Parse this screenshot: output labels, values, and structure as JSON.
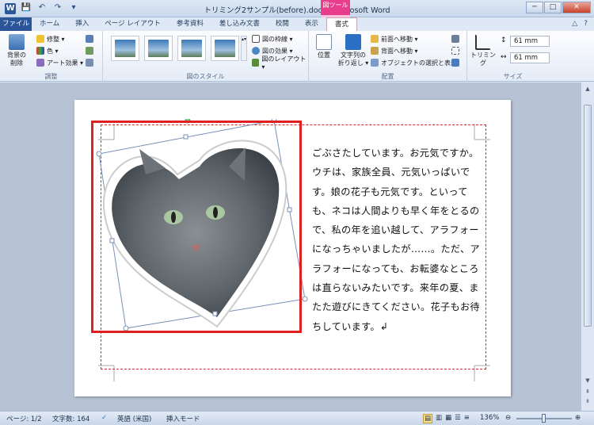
{
  "window": {
    "title": "トリミング2サンプル(before).docx - Microsoft Word",
    "context_tools": "図ツール",
    "app_icon": "W"
  },
  "quick_access": {
    "save": "💾",
    "undo": "↶",
    "redo": "↷",
    "customize": "▾"
  },
  "window_controls": {
    "minimize": "─",
    "maximize": "□",
    "close": "✕"
  },
  "tabs": [
    {
      "label": "ファイル"
    },
    {
      "label": "ホーム"
    },
    {
      "label": "挿入"
    },
    {
      "label": "ページ レイアウト"
    },
    {
      "label": "参考資料"
    },
    {
      "label": "差し込み文書"
    },
    {
      "label": "校閲"
    },
    {
      "label": "表示"
    },
    {
      "label": "書式"
    }
  ],
  "tabs_right": {
    "minimize_ribbon": "△",
    "help": "?"
  },
  "ribbon": {
    "adjust": {
      "label": "調整",
      "remove_bg": "背景の\n削除",
      "corrections": "修整 ▾",
      "color": "色 ▾",
      "artistic": "アート効果 ▾"
    },
    "styles": {
      "label": "図のスタイル",
      "border": "図の枠線 ▾",
      "effects": "図の効果 ▾",
      "layout": "図のレイアウト ▾"
    },
    "arrange": {
      "label": "配置",
      "position": "位置",
      "wrap": "文字列の\n折り返し ▾",
      "bring_forward": "前面へ移動 ▾",
      "send_backward": "背面へ移動 ▾",
      "selection_pane": "オブジェクトの選択と表示"
    },
    "size": {
      "label": "サイズ",
      "crop": "トリミング",
      "height": "61 mm",
      "width": "61 mm"
    }
  },
  "document": {
    "text": "ごぶさたしています。お元気ですか。ウチは、家族全員、元気いっぱいです。娘の花子も元気です。といっても、ネコは人間よりも早く年をとるので、私の年を追い越して、アラフォーになっちゃいましたが……。ただ、アラフォーになっても、お転婆なところは直らないみたいです。来年の夏、またた遊びにきてください。花子もお待ちしています。↲"
  },
  "status": {
    "page": "ページ: 1/2",
    "words": "文字数: 164",
    "language": "英語 (米国)",
    "mode": "挿入モード",
    "zoom": "136%"
  },
  "colors": {
    "accent": "#2a5699",
    "context": "#e83d8c",
    "selection": "#e02020"
  }
}
